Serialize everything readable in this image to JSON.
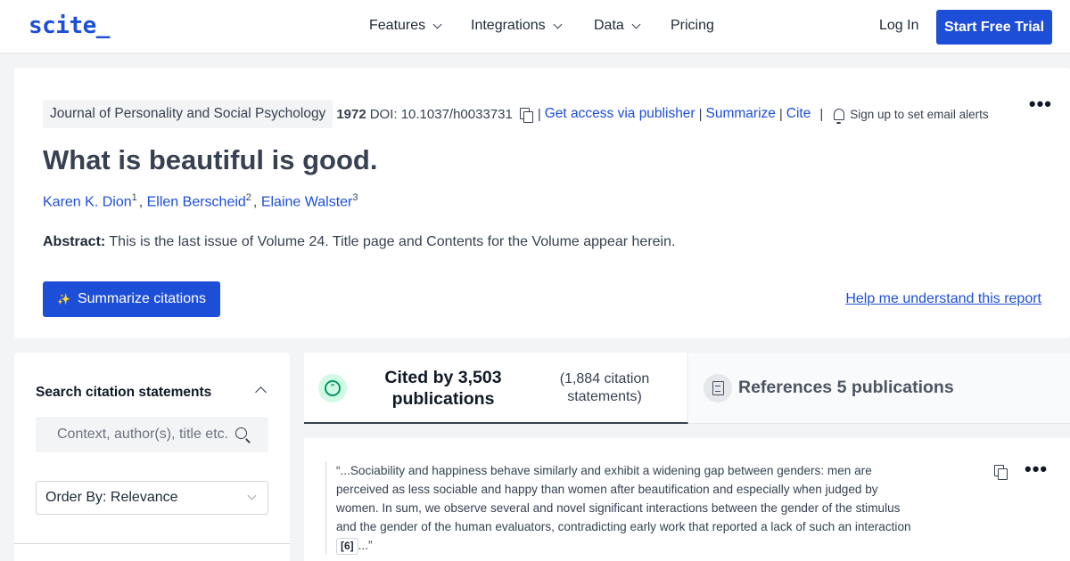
{
  "nav": {
    "logo": "scite_",
    "items": [
      {
        "label": "Features",
        "has_dropdown": true
      },
      {
        "label": "Integrations",
        "has_dropdown": true
      },
      {
        "label": "Data",
        "has_dropdown": true
      },
      {
        "label": "Pricing",
        "has_dropdown": false
      }
    ],
    "login": "Log In",
    "trial": "Start Free Trial"
  },
  "paper": {
    "journal": "Journal of Personality and Social Psychology",
    "year": "1972",
    "doi": "DOI: 10.1037/h0033731",
    "links": [
      "Get access via publisher",
      "Summarize",
      "Cite"
    ],
    "alerts": "Sign up to set email alerts",
    "title": "What is beautiful is good.",
    "authors": [
      {
        "name": "Karen K. Dion",
        "sup": "1"
      },
      {
        "name": "Ellen Berscheid",
        "sup": "2"
      },
      {
        "name": "Elaine Walster",
        "sup": "3"
      }
    ],
    "abstract_label": "Abstract:",
    "abstract": "This is the last issue of Volume 24. Title page and Contents for the Volume appear herein.",
    "summarize_button": "Summarize citations",
    "help_link": "Help me understand this report"
  },
  "sidebar": {
    "title": "Search citation statements",
    "search_placeholder": "Context, author(s), title etc.",
    "order_by": "Order By: Relevance"
  },
  "tabs": {
    "cited": "Cited by 3,503 publications",
    "cited_statements": "(1,884 citation statements)",
    "references": "References 5 publications"
  },
  "citation": {
    "text": "“...Sociability and happiness behave similarly and exhibit a widening gap between genders: men are perceived as less sociable and happy than women after beautification and especially when judged by women. In sum, we observe several and novel significant interactions between the gender of the stimulus and the gender of the human evaluators, contradicting early work that reported a lack of such an interaction",
    "ref": "[6]",
    "tail": "...”"
  },
  "colors": {
    "accent": "#1d4ed8",
    "cited_green": "#059669"
  }
}
